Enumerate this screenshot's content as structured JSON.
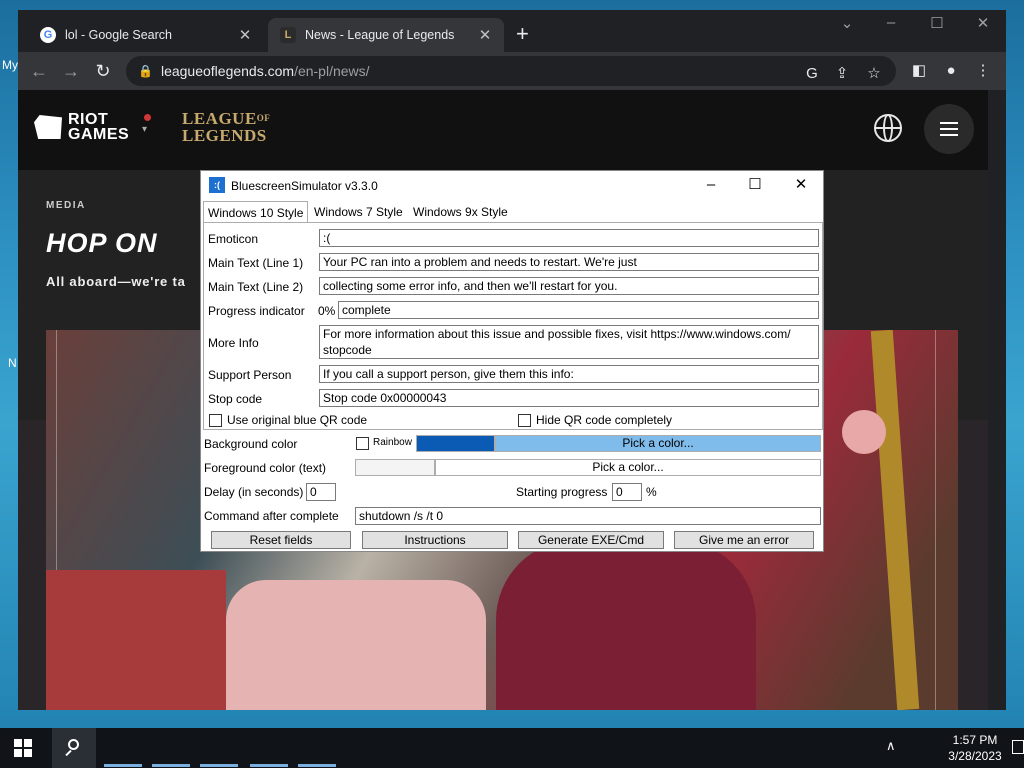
{
  "desktop": {
    "label_my": "My",
    "label_n": "N"
  },
  "browser": {
    "tabs": [
      {
        "label": "lol - Google Search",
        "icon": "google-icon"
      },
      {
        "label": "News - League of Legends",
        "icon": "league-icon"
      }
    ],
    "url_domain": "leagueoflegends.com",
    "url_path": "/en-pl/news/"
  },
  "page": {
    "riot_logo": "RIOT GAMES",
    "lol_logo": {
      "line1": "LEAGUE",
      "of": "OF",
      "line2": "LEGENDS"
    },
    "hero": {
      "kicker": "MEDIA",
      "title": "HOP ON",
      "subtitle": "All aboard—we're ta"
    }
  },
  "bss": {
    "title": "BluescreenSimulator v3.3.0",
    "tabs": [
      "Windows 10 Style",
      "Windows 7 Style",
      "Windows 9x Style"
    ],
    "fields": {
      "emoticon": {
        "label": "Emoticon",
        "value": ":("
      },
      "main1": {
        "label": "Main Text (Line 1)",
        "value": "Your PC ran into a problem and needs to restart. We're just"
      },
      "main2": {
        "label": "Main Text (Line 2)",
        "value": "collecting some error info, and then we'll restart for you."
      },
      "progress": {
        "label": "Progress indicator",
        "prefix": "0%",
        "value": "complete"
      },
      "moreinfo": {
        "label": "More Info",
        "value": "For more information about this issue and possible fixes, visit https://www.windows.com/ stopcode"
      },
      "support": {
        "label": "Support Person",
        "value": "If you call a support person, give them this info:"
      },
      "stopcode": {
        "label": "Stop code",
        "value": "Stop code 0x00000043"
      }
    },
    "checkboxes": {
      "use_blue_qr": "Use original blue QR code",
      "hide_qr": "Hide QR code completely"
    },
    "lower": {
      "bg_label": "Background color",
      "rainbow": "Rainbow",
      "bg_pick": "Pick a color...",
      "fg_label": "Foreground color (text)",
      "fg_pick": "Pick a color...",
      "delay_label": "Delay (in seconds)",
      "delay_value": "0",
      "start_label": "Starting progress",
      "start_value": "0",
      "percent": "%",
      "cmd_label": "Command after complete",
      "cmd_value": "shutdown /s /t 0"
    },
    "buttons": [
      "Reset fields",
      "Instructions",
      "Generate EXE/Cmd",
      "Give me an error"
    ],
    "colors": {
      "bg_swatch": "#0b5bb5",
      "bg_pick": "#7fbcec"
    }
  },
  "taskbar": {
    "time": "1:57 PM",
    "date": "3/28/2023"
  }
}
